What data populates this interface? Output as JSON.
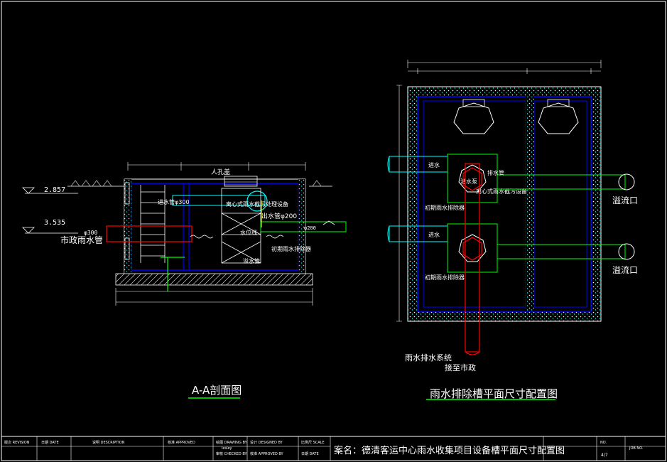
{
  "section": {
    "title": "A-A剖面图",
    "elev_top": "2.857",
    "elev_bottom": "3.535",
    "manhole": "人孔盖",
    "inlet_pipe": "进水管φ300",
    "centrifugal_unit": "离心式雨水截污处理设备",
    "outlet_pipe": "出水管φ200",
    "municipal_pipe": "市政雨水管",
    "municipal_dia": "φ300",
    "inlet_dia": "进水管φ300",
    "first_flush": "初期雨水排除器",
    "overflow": "溢水管",
    "pipe_tag": "φ200",
    "water_level": "水位线"
  },
  "plan": {
    "title": "雨水排除槽平面尺寸配置图",
    "left_label_1": "进水",
    "left_label_2": "进水",
    "right_label_1": "溢流口",
    "right_label_2": "溢流口",
    "pump_label": "潜水泵",
    "pipe_label": "排水管",
    "box_label_1": "初期雨水排除器",
    "box_label_2": "初期雨水排除器",
    "equip_label": "离心式雨水截污设备",
    "bottom_label_1": "接至市政",
    "bottom_label_2": "雨水排水系统"
  },
  "title_block": {
    "revision": "版次 REVISION",
    "date": "日期 DATE",
    "description": "说明 DESCRIPTION",
    "approved": "核准 APPROVED",
    "drawn_by": "绘图 DRAWING BY",
    "drawn_name": "lesley",
    "designed_by": "设计 DESIGNED BY",
    "checked_by": "审核 CHECKED BY",
    "approved_by": "核准 APPROVED BY",
    "scale": "比例尺 SCALE",
    "date2": "日期 DATE",
    "project": "案名：德清客运中心雨水收集项目设备槽平面尺寸配置图",
    "sheet_no": "NO.",
    "sheet_val": "4/7",
    "job_no": "JOB NO."
  },
  "colors": {
    "background": "#000000",
    "wall": "#0000ff",
    "cyan": "#00ffff",
    "green": "#00ff00",
    "red": "#ff0000",
    "white": "#ffffff",
    "yellow": "#ffff00"
  }
}
